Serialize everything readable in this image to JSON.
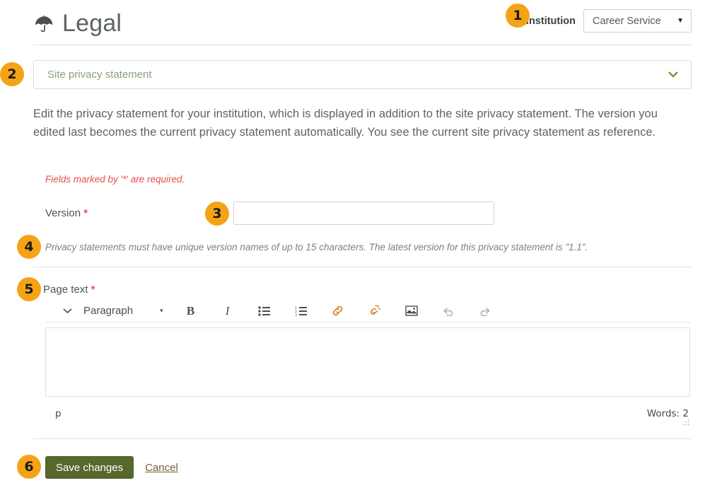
{
  "header": {
    "title": "Legal",
    "icon": "umbrella-icon",
    "institution_label": "Institution",
    "institution_value": "Career Service",
    "institution_caret": "▼"
  },
  "accordion": {
    "title": "Site privacy statement",
    "chevron": "⌄",
    "icon": "chevron-down-icon"
  },
  "intro": {
    "text": "Edit the privacy statement for your institution, which is displayed in addition to the site privacy statement. The version you edited last becomes the current privacy statement automatically. You see the current site privacy statement as reference."
  },
  "form": {
    "required_note": "Fields marked by '*' are required.",
    "version_label": "Version",
    "version_required_mark": "*",
    "version_value": "",
    "version_placeholder": "",
    "help_text": "Privacy statements must have unique version names of up to 15 characters. The latest version for this privacy statement is \"1.1\".",
    "pagetext_label": "Page text",
    "pagetext_required_mark": "*"
  },
  "editor": {
    "format_value": "Paragraph",
    "format_caret": "▾",
    "expand_chevron": "⌄",
    "buttons": [
      {
        "name": "toolbar-expand-icon",
        "label": "⌄"
      },
      {
        "name": "format-select",
        "label": "Paragraph"
      },
      {
        "name": "bold-icon",
        "label": "B"
      },
      {
        "name": "italic-icon",
        "label": "I"
      },
      {
        "name": "bullet-list-icon",
        "label": "Bullet list"
      },
      {
        "name": "numbered-list-icon",
        "label": "Numbered list"
      },
      {
        "name": "link-icon",
        "label": "Link"
      },
      {
        "name": "unlink-icon",
        "label": "Unlink"
      },
      {
        "name": "image-icon",
        "label": "Image"
      },
      {
        "name": "undo-icon",
        "label": "Undo"
      },
      {
        "name": "redo-icon",
        "label": "Redo"
      }
    ],
    "content": "",
    "status_path": "p",
    "status_words": "Words: 2"
  },
  "footer": {
    "save_label": "Save changes",
    "cancel_label": "Cancel"
  },
  "badges": [
    {
      "number": "1"
    },
    {
      "number": "2"
    },
    {
      "number": "3"
    },
    {
      "number": "4"
    },
    {
      "number": "5"
    },
    {
      "number": "6"
    }
  ],
  "colors": {
    "badge": "#f5a316",
    "save_button": "#57682c",
    "required_red": "#e4504b",
    "accordion_text": "#8aa17c",
    "chevron_green": "#6f9c2e",
    "cancel_link": "#7a5b2e",
    "link_icon_orange": "#d9822b"
  }
}
